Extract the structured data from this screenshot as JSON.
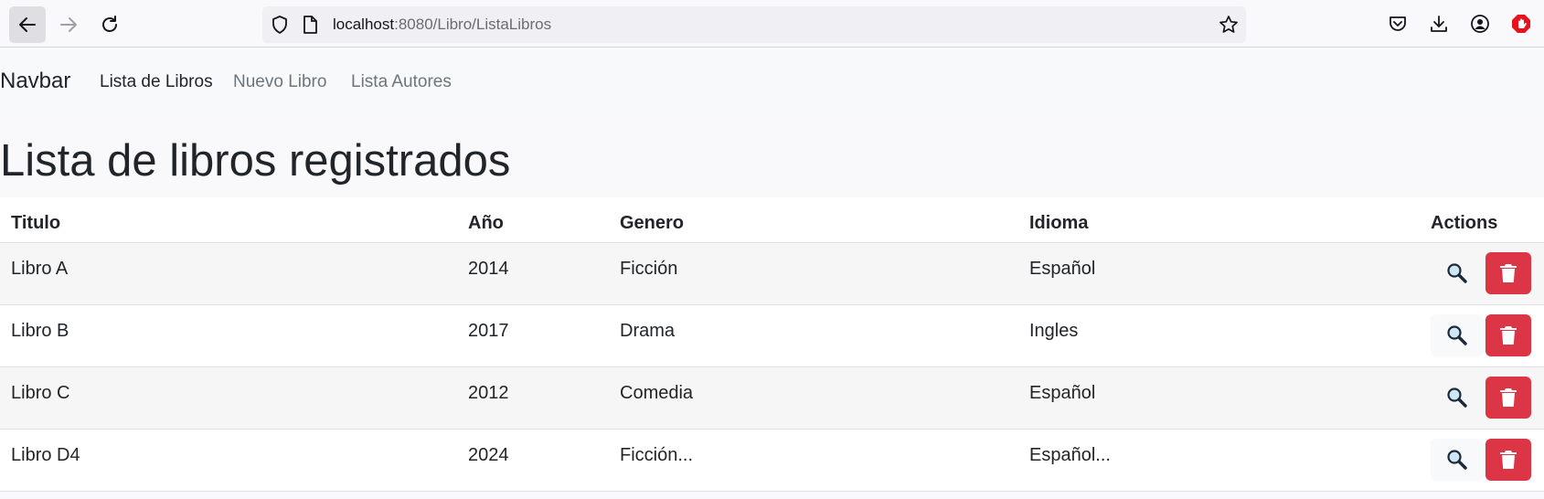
{
  "browser": {
    "url_host": "localhost",
    "url_path": ":8080/Libro/ListaLibros"
  },
  "navbar": {
    "brand": "Navbar",
    "links": [
      {
        "label": "Lista de Libros",
        "active": true
      },
      {
        "label": "Nuevo Libro",
        "active": false
      },
      {
        "label": "Lista Autores",
        "active": false
      }
    ]
  },
  "main": {
    "title": "Lista de libros registrados"
  },
  "table": {
    "headers": [
      "Titulo",
      "Año",
      "Genero",
      "Idioma",
      "Actions"
    ],
    "rows": [
      {
        "titulo": "Libro A",
        "anio": "2014",
        "genero": "Ficción",
        "idioma": "Español"
      },
      {
        "titulo": "Libro B",
        "anio": "2017",
        "genero": "Drama",
        "idioma": "Ingles"
      },
      {
        "titulo": "Libro C",
        "anio": "2012",
        "genero": "Comedia",
        "idioma": "Español"
      },
      {
        "titulo": "Libro D4",
        "anio": "2024",
        "genero": "Ficción...",
        "idioma": "Español..."
      }
    ]
  },
  "colors": {
    "danger": "#dc3545",
    "navbar_bg": "#f8f9fa"
  },
  "icons": {
    "view": "magnifying-glass-icon",
    "delete": "trash-icon"
  }
}
